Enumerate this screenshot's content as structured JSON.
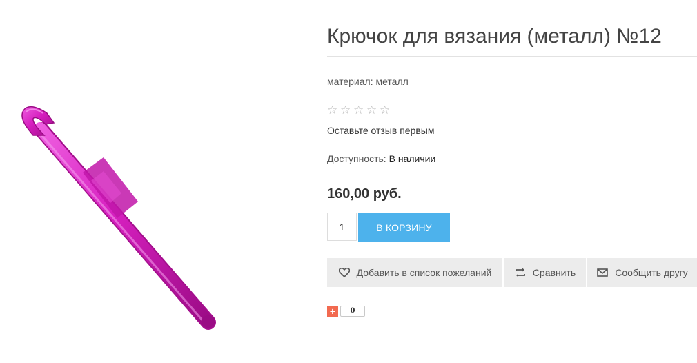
{
  "product": {
    "title": "Крючок для вязания (металл) №12",
    "material": "материал: металл",
    "image_alt": "crochet hook, magenta",
    "rating": {
      "value": 0,
      "max": 5,
      "stars": [
        "☆",
        "☆",
        "☆",
        "☆",
        "☆"
      ]
    },
    "review_link": "Оставьте отзыв первым",
    "availability": {
      "label": "Доступность:",
      "value": "В наличии"
    },
    "price": "160,00 руб.",
    "quantity": "1",
    "cart_button": "В КОРЗИНУ",
    "colors": {
      "accent": "#4db2ec",
      "hook": "#d81fc0",
      "share": "#f26a50"
    }
  },
  "actions": {
    "wishlist": {
      "label": "Добавить в список пожеланий",
      "icon": "heart-icon"
    },
    "compare": {
      "label": "Сравнить",
      "icon": "compare-arrows-icon"
    },
    "tell_friend": {
      "label": "Сообщить другу",
      "icon": "envelope-icon"
    }
  },
  "share": {
    "icon": "plus-icon",
    "symbol": "+",
    "count": "0"
  }
}
